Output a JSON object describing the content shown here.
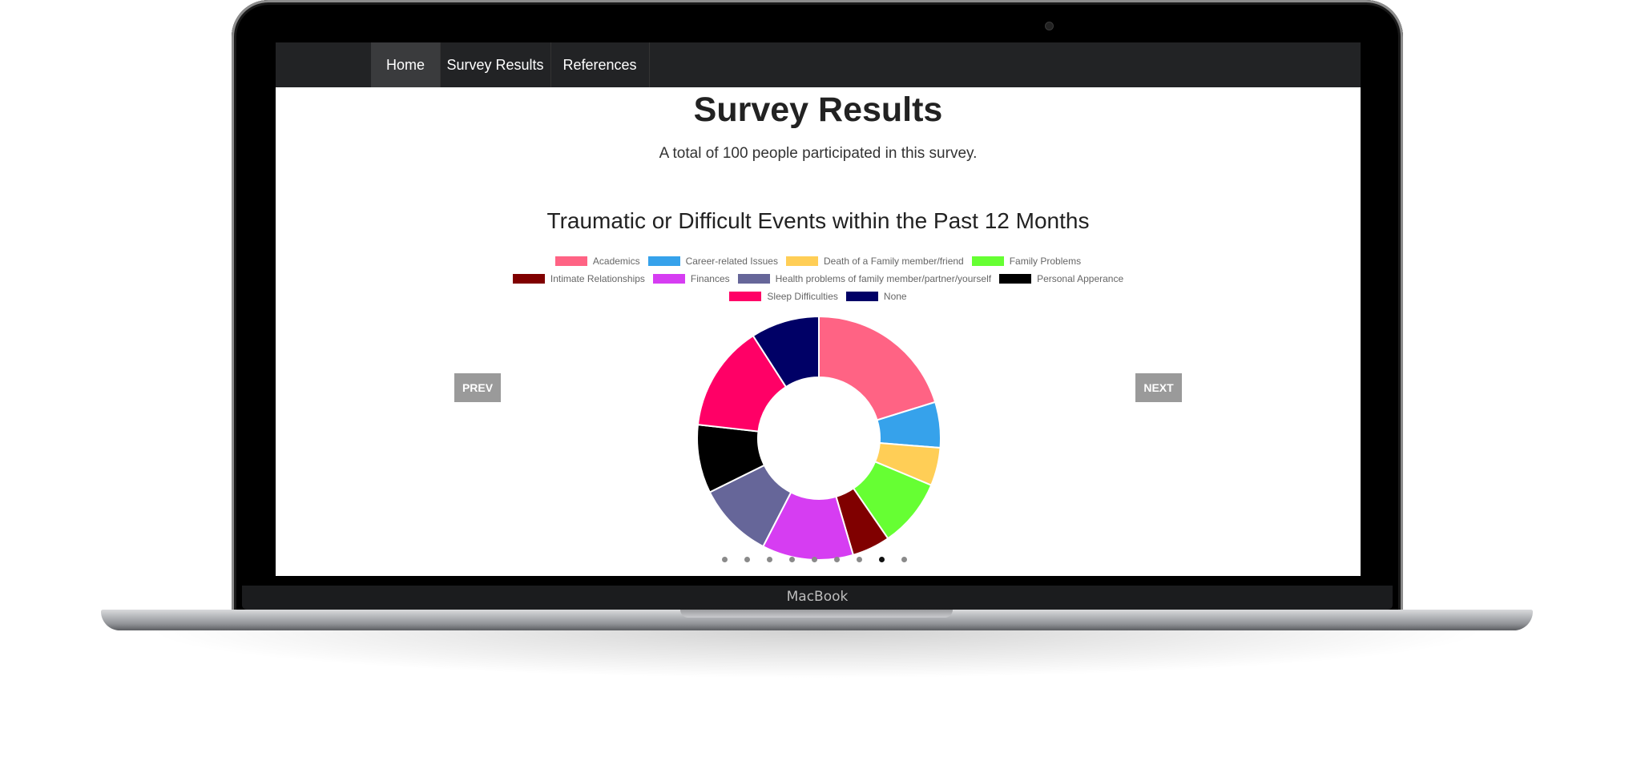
{
  "device": {
    "brand_label": "MacBook"
  },
  "nav": {
    "items": [
      {
        "label": "Home",
        "active": true
      },
      {
        "label": "Survey Results",
        "active": false
      },
      {
        "label": "References",
        "active": false
      }
    ]
  },
  "page": {
    "title": "Survey Results",
    "subtitle": "A total of 100 people participated in this survey."
  },
  "carousel": {
    "prev_label": "PREV",
    "next_label": "NEXT",
    "slide_count": 9,
    "active_index": 7
  },
  "chart_data": {
    "type": "pie",
    "variant": "doughnut",
    "title": "Traumatic or Difficult Events within the Past 12 Months",
    "legend_position": "top",
    "categories": [
      "Academics",
      "Career-related Issues",
      "Death of a Family member/friend",
      "Family Problems",
      "Intimate Relationships",
      "Finances",
      "Health problems of family member/partner/yourself",
      "Personal Apperance",
      "Sleep Difficulties",
      "None"
    ],
    "values": [
      20,
      6,
      5,
      9,
      5,
      12,
      10,
      9,
      14,
      9
    ],
    "colors": [
      "#ff6384",
      "#36a2eb",
      "#ffce56",
      "#66ff33",
      "#800000",
      "#d63df2",
      "#666699",
      "#000000",
      "#ff0066",
      "#000066"
    ],
    "legend_rows": [
      [
        0,
        1,
        2,
        3
      ],
      [
        4,
        5,
        6,
        7
      ],
      [
        8,
        9
      ]
    ]
  }
}
